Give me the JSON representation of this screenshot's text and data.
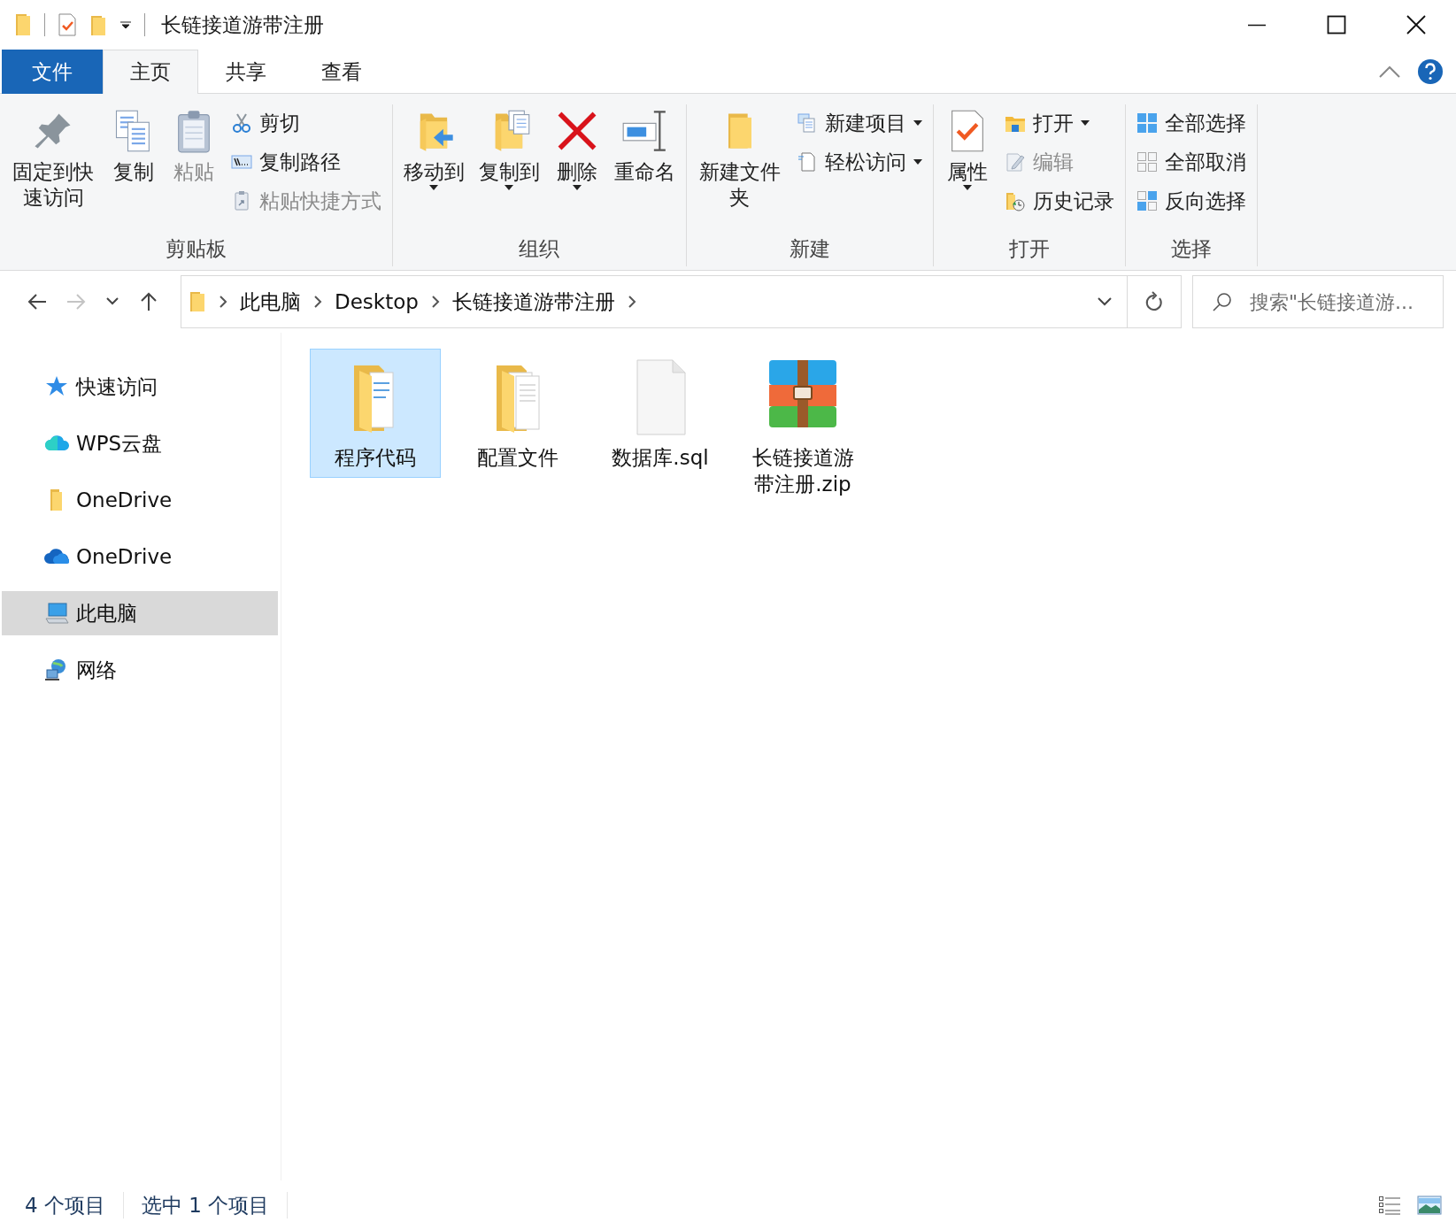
{
  "window": {
    "title": "长链接道游带注册"
  },
  "tabs": [
    {
      "label": "文件",
      "kind": "file",
      "selected": false
    },
    {
      "label": "主页",
      "kind": "tab",
      "selected": true
    },
    {
      "label": "共享",
      "kind": "tab",
      "selected": false
    },
    {
      "label": "查看",
      "kind": "tab",
      "selected": false
    }
  ],
  "ribbon_groups": [
    {
      "label": "剪贴板",
      "commands": [
        {
          "label": "固定到快速访问",
          "kind": "large",
          "disabled": false,
          "dropdown": false
        },
        {
          "label": "复制",
          "kind": "large",
          "disabled": false,
          "dropdown": false
        },
        {
          "label": "粘贴",
          "kind": "large",
          "disabled": true,
          "dropdown": false
        },
        {
          "label": "剪切",
          "kind": "small",
          "disabled": false,
          "dropdown": false
        },
        {
          "label": "复制路径",
          "kind": "small",
          "disabled": false,
          "dropdown": false
        },
        {
          "label": "粘贴快捷方式",
          "kind": "small",
          "disabled": true,
          "dropdown": false
        }
      ]
    },
    {
      "label": "组织",
      "commands": [
        {
          "label": "移动到",
          "kind": "large",
          "disabled": false,
          "dropdown": true
        },
        {
          "label": "复制到",
          "kind": "large",
          "disabled": false,
          "dropdown": true
        },
        {
          "label": "删除",
          "kind": "large",
          "disabled": false,
          "dropdown": true
        },
        {
          "label": "重命名",
          "kind": "large",
          "disabled": false,
          "dropdown": false
        }
      ]
    },
    {
      "label": "新建",
      "commands": [
        {
          "label": "新建文件夹",
          "kind": "large",
          "disabled": false,
          "dropdown": false
        },
        {
          "label": "新建项目",
          "kind": "small",
          "disabled": false,
          "dropdown": true
        },
        {
          "label": "轻松访问",
          "kind": "small",
          "disabled": false,
          "dropdown": true
        }
      ]
    },
    {
      "label": "打开",
      "commands": [
        {
          "label": "属性",
          "kind": "large",
          "disabled": false,
          "dropdown": true
        },
        {
          "label": "打开",
          "kind": "small",
          "disabled": false,
          "dropdown": true
        },
        {
          "label": "编辑",
          "kind": "small",
          "disabled": true,
          "dropdown": false
        },
        {
          "label": "历史记录",
          "kind": "small",
          "disabled": false,
          "dropdown": false
        }
      ]
    },
    {
      "label": "选择",
      "commands": [
        {
          "label": "全部选择",
          "kind": "small",
          "disabled": false,
          "dropdown": false
        },
        {
          "label": "全部取消",
          "kind": "small",
          "disabled": false,
          "dropdown": false
        },
        {
          "label": "反向选择",
          "kind": "small",
          "disabled": false,
          "dropdown": false
        }
      ]
    }
  ],
  "navigation": [
    {
      "kind": "back",
      "disabled": false
    },
    {
      "kind": "forward",
      "disabled": true
    },
    {
      "kind": "recent",
      "disabled": false
    },
    {
      "kind": "up",
      "disabled": false
    }
  ],
  "breadcrumbs": [
    "此电脑",
    "Desktop",
    "长链接道游带注册"
  ],
  "search": {
    "placeholder": "搜索\"长链接道游..."
  },
  "sidebar": {
    "items": [
      {
        "label": "快速访问",
        "kind": "star",
        "selected": false
      },
      {
        "label": "WPS云盘",
        "kind": "wps",
        "selected": false
      },
      {
        "label": "OneDrive",
        "kind": "folder",
        "selected": false
      },
      {
        "label": "OneDrive",
        "kind": "cloud",
        "selected": false
      },
      {
        "label": "此电脑",
        "kind": "computer",
        "selected": true
      },
      {
        "label": "网络",
        "kind": "network",
        "selected": false
      }
    ]
  },
  "files": [
    {
      "name": "程序代码",
      "kind": "folder",
      "selected": true
    },
    {
      "name": "配置文件",
      "kind": "folder",
      "selected": false
    },
    {
      "name": "数据库.sql",
      "kind": "file",
      "selected": false
    },
    {
      "name": "长链接道游带注册.zip",
      "kind": "archive",
      "selected": false
    }
  ],
  "status_bar": {
    "items": [
      "4 个项目",
      "选中 1 个项目"
    ]
  }
}
